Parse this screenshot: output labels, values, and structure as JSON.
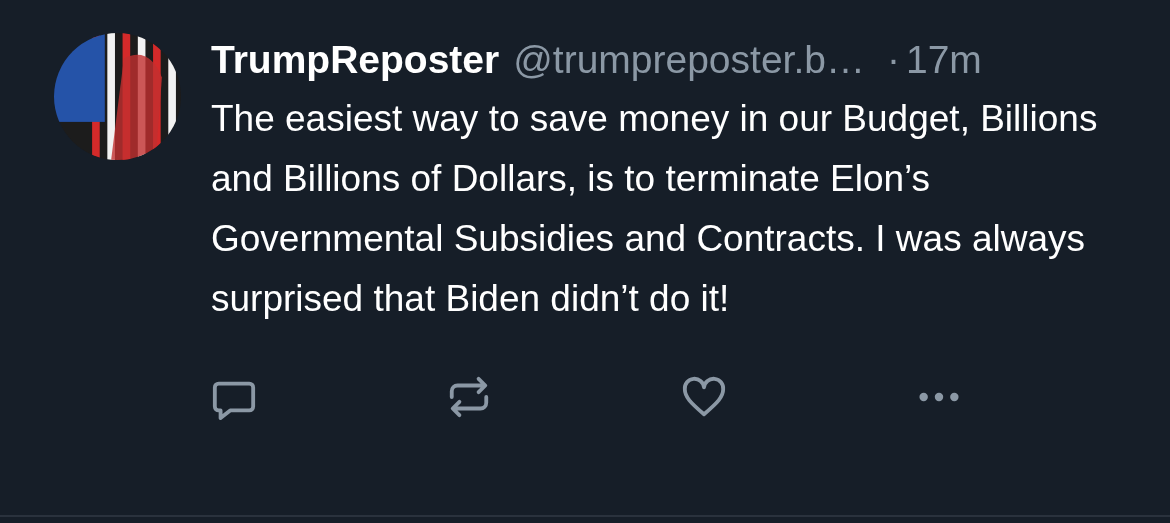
{
  "post": {
    "author": {
      "name": "TrumpReposter",
      "handle": "@trumpreposter.b…",
      "separator": "·",
      "time": "17m"
    },
    "text": "The easiest way to save money in our Budget, Billions and Billions of Dollars, is to terminate Elon’s Governmental Subsidies and Contracts. I was always surprised that Biden didn’t do it!",
    "actions": [
      {
        "kind": "reply"
      },
      {
        "kind": "repost"
      },
      {
        "kind": "like"
      },
      {
        "kind": "more"
      }
    ]
  }
}
